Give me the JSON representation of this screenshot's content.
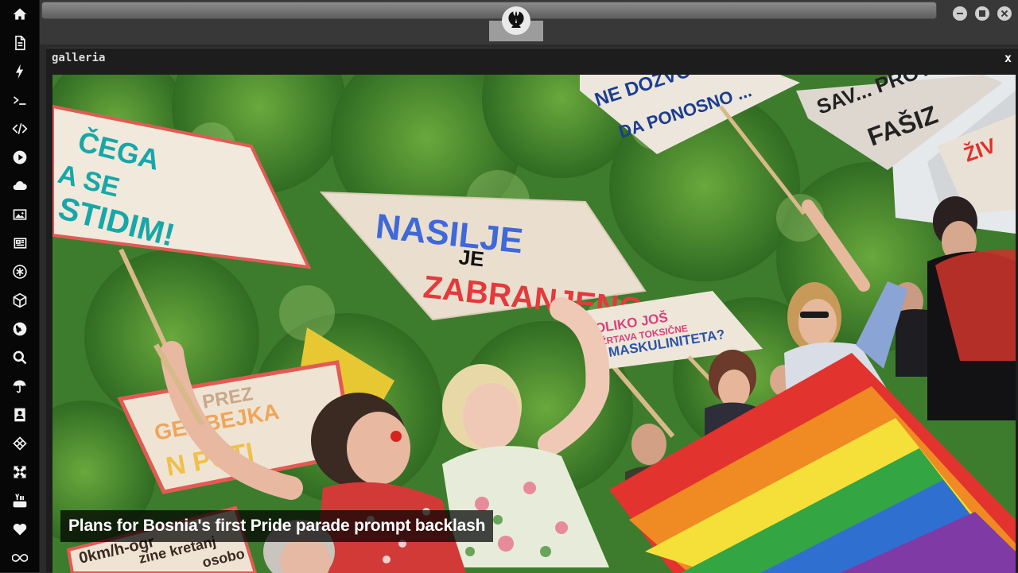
{
  "sidebar": {
    "items": [
      {
        "icon": "home-icon"
      },
      {
        "icon": "document-icon"
      },
      {
        "icon": "lightning-icon"
      },
      {
        "icon": "terminal-icon"
      },
      {
        "icon": "code-icon"
      },
      {
        "icon": "play-icon"
      },
      {
        "icon": "cloud-icon"
      },
      {
        "icon": "image-icon"
      },
      {
        "icon": "newspaper-icon"
      },
      {
        "icon": "asterisk-icon"
      },
      {
        "icon": "hexagon-icon"
      },
      {
        "icon": "globe-icon"
      },
      {
        "icon": "search-icon"
      },
      {
        "icon": "umbrella-icon"
      },
      {
        "icon": "contact-icon"
      },
      {
        "icon": "codepen-icon"
      },
      {
        "icon": "expand-icon"
      },
      {
        "icon": "youtube-icon"
      },
      {
        "icon": "heart-icon"
      },
      {
        "icon": "infinity-icon"
      }
    ]
  },
  "topbar": {
    "logo_icon": "rebel-alliance-icon",
    "window_buttons": [
      "minimize-icon",
      "maximize-icon",
      "close-icon"
    ]
  },
  "gallery": {
    "title": "galleria",
    "close_label": "x",
    "caption": "Plans for Bosnia's first Pride parade prompt backlash",
    "signs": {
      "sign1_line1": "ČEGA",
      "sign1_line2": "A SE",
      "sign1_line3": "STIDIM!",
      "sign2_line1": "NASILJE",
      "sign2_line2": "JE",
      "sign2_line3": "ZABRANJENO",
      "sign3_line1": "NE DOZVO",
      "sign3_line2": "DA PONOSNO ...",
      "sign4_line1": "SAV... PROTIV",
      "sign4_line2": "FAŠIZ",
      "sign5_line1": "ŽIV",
      "sign6_line1": "OLIKO JOŠ",
      "sign6_line2": "ŽRTAVA TOKSIČNE",
      "sign6_line3": "MASKULINITETA?",
      "sign7_line1": "PREZ",
      "sign7_line2": "GEJ BEJKA",
      "sign7_line3": "N PUTI",
      "sign8_line1": "0km/h-ogr",
      "sign8_line2": "zine kretanj",
      "sign8_line3": "osobo"
    }
  },
  "colors": {
    "sidebar_bg": "#070707",
    "panel_bg": "#1d1d1d",
    "caption_bg": "#000000"
  }
}
